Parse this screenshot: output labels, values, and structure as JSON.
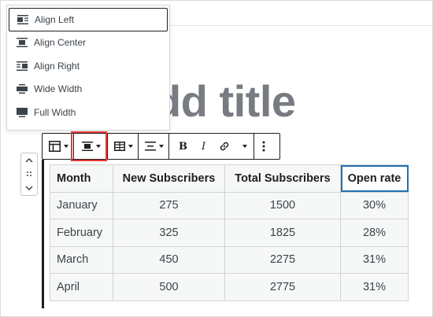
{
  "align_menu": {
    "items": [
      {
        "label": "Align Left",
        "icon": "align-left-icon",
        "active": true
      },
      {
        "label": "Align Center",
        "icon": "align-center-icon",
        "active": false
      },
      {
        "label": "Align Right",
        "icon": "align-right-icon",
        "active": false
      },
      {
        "label": "Wide Width",
        "icon": "wide-width-icon",
        "active": false
      },
      {
        "label": "Full Width",
        "icon": "full-width-icon",
        "active": false
      }
    ]
  },
  "post_title": "dd title",
  "toolbar": {
    "bold_label": "B",
    "italic_label": "I",
    "highlight_color": "#e53935"
  },
  "table": {
    "headers": [
      "Month",
      "New Subscribers",
      "Total Subscribers",
      "Open rate"
    ],
    "rows": [
      [
        "January",
        "275",
        "1500",
        "30%"
      ],
      [
        "February",
        "325",
        "1825",
        "28%"
      ],
      [
        "March",
        "450",
        "2275",
        "31%"
      ],
      [
        "April",
        "500",
        "2775",
        "31%"
      ]
    ]
  },
  "colors": {
    "accent": "#2271b1",
    "title_gray": "#787c82",
    "table_bg": "#f6f7f7"
  }
}
